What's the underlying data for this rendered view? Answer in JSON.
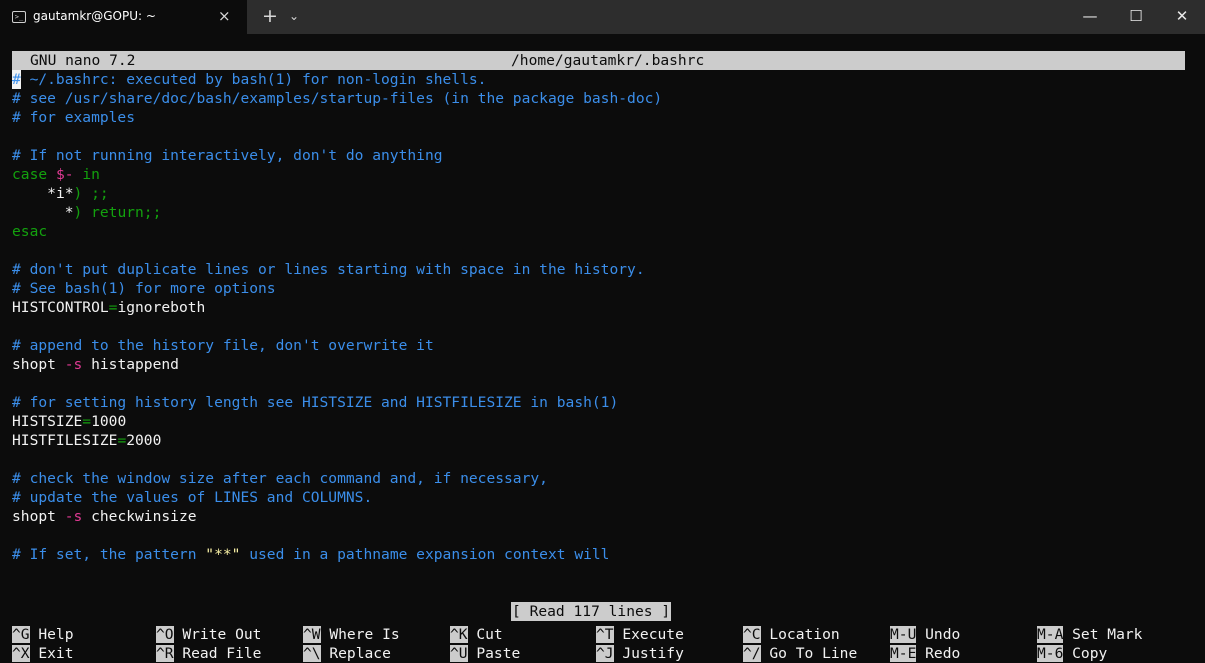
{
  "window": {
    "tab_title": "gautamkr@GOPU: ~",
    "tab_icon": "terminal-icon",
    "close_tab_glyph": "×",
    "new_tab_glyph": "+",
    "dropdown_glyph": "⌄",
    "minimize_glyph": "—",
    "maximize_glyph": "☐",
    "close_glyph": "✕"
  },
  "nano": {
    "version": "GNU nano 7.2",
    "file_path": "/home/gautamkr/.bashrc",
    "status_message": "[ Read 117 lines ]",
    "lines": [
      "# ~/.bashrc: executed by bash(1) for non-login shells.",
      "# see /usr/share/doc/bash/examples/startup-files (in the package bash-doc)",
      "# for examples",
      "",
      "# If not running interactively, don't do anything",
      "case $- in",
      "    *i*) ;;",
      "      *) return;;",
      "esac",
      "",
      "# don't put duplicate lines or lines starting with space in the history.",
      "# See bash(1) for more options",
      "HISTCONTROL=ignoreboth",
      "",
      "# append to the history file, don't overwrite it",
      "shopt -s histappend",
      "",
      "# for setting history length see HISTSIZE and HISTFILESIZE in bash(1)",
      "HISTSIZE=1000",
      "HISTFILESIZE=2000",
      "",
      "# check the window size after each command and, if necessary,",
      "# update the values of LINES and COLUMNS.",
      "shopt -s checkwinsize",
      "",
      "# If set, the pattern \"**\" used in a pathname expansion context will"
    ],
    "shortcuts_row1": [
      {
        "key": "^G",
        "label": "Help"
      },
      {
        "key": "^O",
        "label": "Write Out"
      },
      {
        "key": "^W",
        "label": "Where Is"
      },
      {
        "key": "^K",
        "label": "Cut"
      },
      {
        "key": "^T",
        "label": "Execute"
      },
      {
        "key": "^C",
        "label": "Location"
      },
      {
        "key": "M-U",
        "label": "Undo"
      },
      {
        "key": "M-A",
        "label": "Set Mark"
      }
    ],
    "shortcuts_row2": [
      {
        "key": "^X",
        "label": "Exit"
      },
      {
        "key": "^R",
        "label": "Read File"
      },
      {
        "key": "^\\",
        "label": "Replace"
      },
      {
        "key": "^U",
        "label": "Paste"
      },
      {
        "key": "^J",
        "label": "Justify"
      },
      {
        "key": "^/",
        "label": "Go To Line"
      },
      {
        "key": "M-E",
        "label": "Redo"
      },
      {
        "key": "M-6",
        "label": "Copy"
      }
    ]
  }
}
